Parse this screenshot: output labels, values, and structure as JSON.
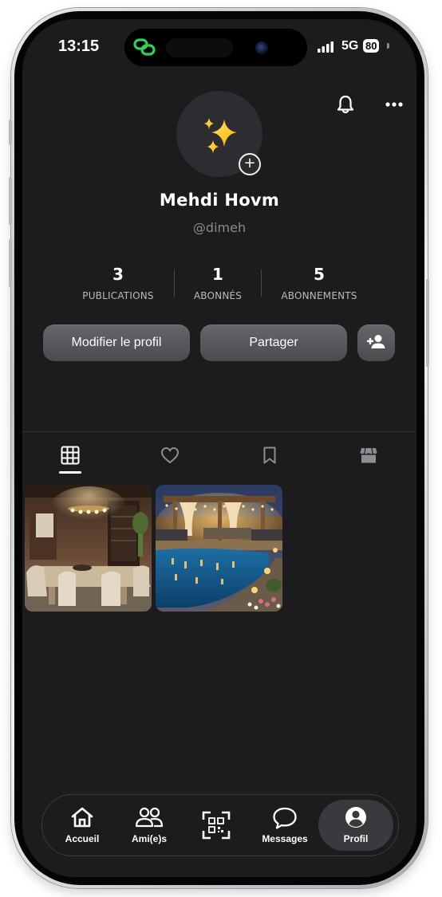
{
  "status_bar": {
    "time": "13:15",
    "network": "5G",
    "battery": "80"
  },
  "header": {
    "notifications_icon": "bell-icon",
    "more_icon": "more-horizontal-icon"
  },
  "profile": {
    "avatar_icon": "sparkles-icon",
    "name": "Mehdi Hovm",
    "handle": "@dimeh",
    "stats": [
      {
        "value": "3",
        "label": "PUBLICATIONS"
      },
      {
        "value": "1",
        "label": "ABONNÉS"
      },
      {
        "value": "5",
        "label": "ABONNEMENTS"
      }
    ]
  },
  "actions": {
    "edit_profile": "Modifier le profil",
    "share": "Partager",
    "add_friend_icon": "person-add-icon"
  },
  "tabs": [
    {
      "icon": "grid-icon",
      "active": true
    },
    {
      "icon": "heart-icon",
      "active": false
    },
    {
      "icon": "bookmark-icon",
      "active": false
    },
    {
      "icon": "shop-icon",
      "active": false
    }
  ],
  "posts": [
    {
      "subject": "dining-room"
    },
    {
      "subject": "pool-patio-night"
    }
  ],
  "bottom_nav": [
    {
      "label": "Accueil",
      "icon": "home-icon",
      "active": false
    },
    {
      "label": "Ami(e)s",
      "icon": "people-icon",
      "active": false
    },
    {
      "label": "",
      "icon": "qr-scan-icon",
      "active": false
    },
    {
      "label": "Messages",
      "icon": "chat-bubble-icon",
      "active": false
    },
    {
      "label": "Profil",
      "icon": "profile-icon",
      "active": true
    }
  ],
  "colors": {
    "background": "#1c1c1f",
    "button": "#55555a",
    "accent_link_icon": "#34d058"
  }
}
